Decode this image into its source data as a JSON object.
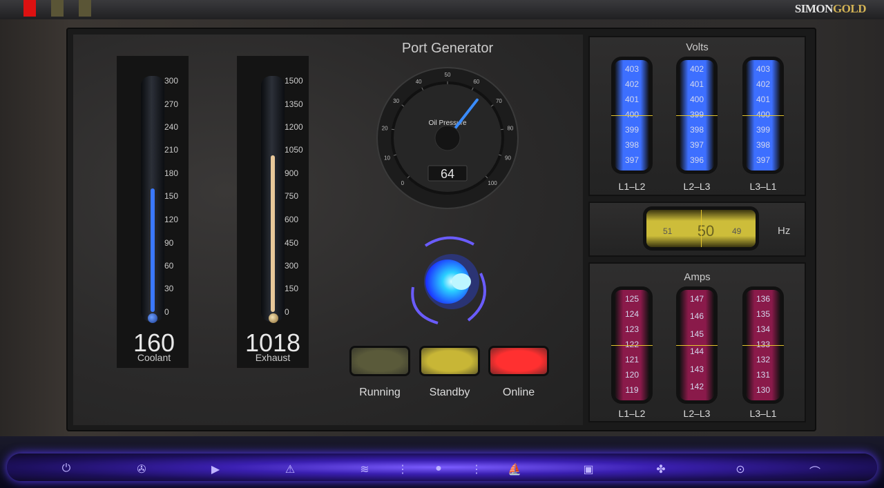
{
  "brand": {
    "part1": "SIMON",
    "part2": "GOLD"
  },
  "gauge": {
    "title": "Port Generator",
    "label": "Oil Pressure",
    "value": "64",
    "ticks": [
      "0",
      "10",
      "20",
      "30",
      "40",
      "50",
      "60",
      "70",
      "80",
      "90",
      "100"
    ]
  },
  "coolant": {
    "label": "Coolant",
    "value": "160",
    "ticks": [
      "300",
      "270",
      "240",
      "210",
      "180",
      "150",
      "120",
      "90",
      "60",
      "30",
      "0"
    ],
    "max": 300,
    "fill_color": "#3a78ff"
  },
  "exhaust": {
    "label": "Exhaust",
    "value": "1018",
    "ticks": [
      "1500",
      "1350",
      "1200",
      "1050",
      "900",
      "750",
      "600",
      "450",
      "300",
      "150",
      "0"
    ],
    "max": 1500,
    "fill_color": "#e8c89a"
  },
  "indicators": [
    {
      "label": "Running",
      "color": "#5a5a3a"
    },
    {
      "label": "Standby",
      "color": "#c8b636"
    },
    {
      "label": "Online",
      "color": "#ff3030"
    }
  ],
  "volts": {
    "title": "Volts",
    "drums": [
      {
        "label": "L1–L2",
        "nums": [
          "403",
          "402",
          "401",
          "400",
          "399",
          "398",
          "397"
        ]
      },
      {
        "label": "L2–L3",
        "nums": [
          "402",
          "401",
          "400",
          "399",
          "398",
          "397",
          "396"
        ]
      },
      {
        "label": "L3–L1",
        "nums": [
          "403",
          "402",
          "401",
          "400",
          "399",
          "398",
          "397"
        ]
      }
    ],
    "color": "#3d6fff"
  },
  "hz": {
    "label": "Hz",
    "left": "51",
    "value": "50",
    "right": "49",
    "color": "#cdbd3a"
  },
  "amps": {
    "title": "Amps",
    "drums": [
      {
        "label": "L1–L2",
        "nums": [
          "125",
          "124",
          "123",
          "122",
          "121",
          "120",
          "119"
        ]
      },
      {
        "label": "L2–L3",
        "nums": [
          "147",
          "146",
          "145",
          "144",
          "143",
          "142"
        ]
      },
      {
        "label": "L3–L1",
        "nums": [
          "136",
          "135",
          "134",
          "133",
          "132",
          "131",
          "130"
        ]
      }
    ],
    "color": "#8a1a4a"
  },
  "dock": {
    "icons": [
      "power-icon",
      "fan-icon",
      "play-icon",
      "warning-icon",
      "waves-icon",
      "menu-dots-icon",
      "orb-icon",
      "menu-dots-icon",
      "sail-icon",
      "engine-icon",
      "propeller-icon",
      "rudder-icon",
      "boat-icon"
    ]
  }
}
